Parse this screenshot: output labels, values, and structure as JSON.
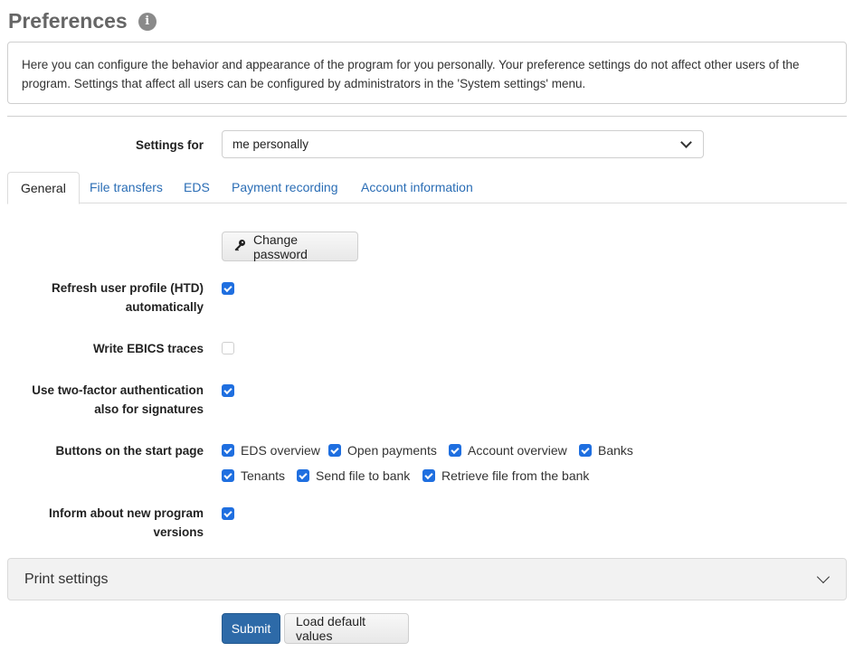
{
  "page": {
    "title": "Preferences",
    "info_glyph": "i",
    "description": "Here you can configure the behavior and appearance of the program for you personally. Your preference settings do not affect other users of the program. Settings that affect all users can be configured by administrators in the 'System settings' menu."
  },
  "settings_for": {
    "label": "Settings for",
    "value": "me personally"
  },
  "tabs": [
    {
      "label": "General",
      "active": true
    },
    {
      "label": "File transfers",
      "active": false
    },
    {
      "label": "EDS",
      "active": false
    },
    {
      "label": "Payment recording",
      "active": false
    },
    {
      "label": "Account information",
      "active": false
    }
  ],
  "general": {
    "change_password_label": "Change password",
    "refresh_htd": {
      "label_line1": "Refresh user profile (HTD)",
      "label_line2": "automatically",
      "checked": true
    },
    "ebics_traces": {
      "label": "Write EBICS traces",
      "checked": false
    },
    "two_factor": {
      "label_line1": "Use two-factor authentication",
      "label_line2": "also for signatures",
      "checked": true
    },
    "start_buttons": {
      "label": "Buttons on the start page",
      "options": [
        {
          "label": "EDS overview",
          "checked": true
        },
        {
          "label": "Open payments",
          "checked": true
        },
        {
          "label": "Account overview",
          "checked": true
        },
        {
          "label": "Banks",
          "checked": true
        },
        {
          "label": "Tenants",
          "checked": true
        },
        {
          "label": "Send file to bank",
          "checked": true
        },
        {
          "label": "Retrieve file from the bank",
          "checked": true
        }
      ]
    },
    "new_versions": {
      "label_line1": "Inform about new program",
      "label_line2": "versions",
      "checked": true
    }
  },
  "print_settings": {
    "label": "Print settings"
  },
  "actions": {
    "submit_label": "Submit",
    "load_defaults_label": "Load default values"
  },
  "colors": {
    "accent": "#1f6fe0",
    "link": "#2a6db5",
    "primary_button": "#2d6aa8",
    "title": "#666666"
  }
}
